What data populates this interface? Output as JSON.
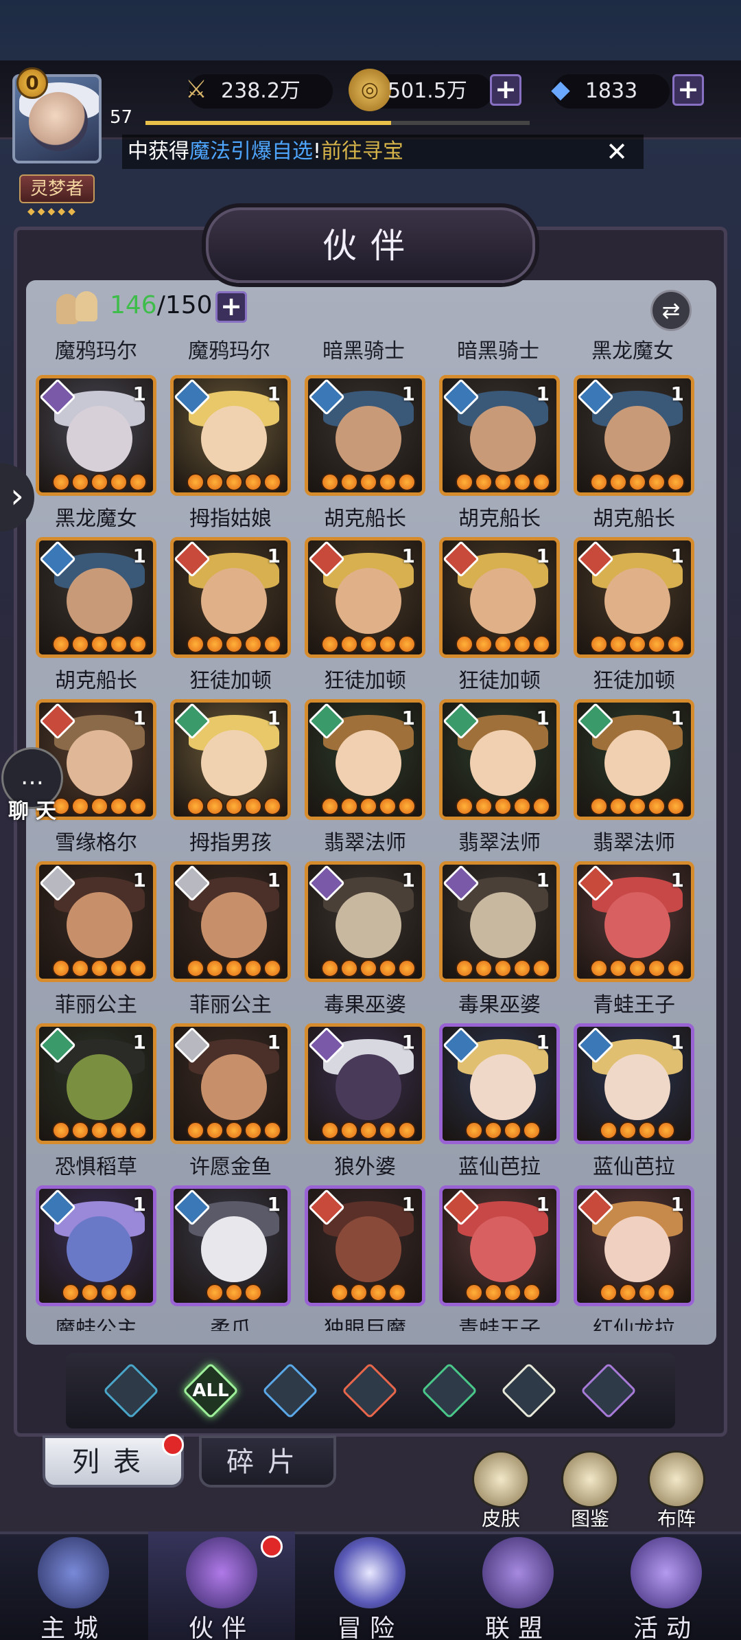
{
  "header": {
    "level_badge": "0",
    "player_level": "57",
    "xp_fraction": 0.64,
    "rank": "灵梦者",
    "rank_stars": "◆◆◆◆◆",
    "power": "238.2万",
    "gold": "501.5万",
    "diamonds": "1833",
    "plus": "+",
    "ticker_prefix": "中获得",
    "ticker_highlight": "魔法引爆自选",
    "ticker_mid": "!",
    "ticker_link": "前往寻宝",
    "ticker_close": "✕"
  },
  "page": {
    "title": "伙伴"
  },
  "roster": {
    "current": "146",
    "max": "/150",
    "plus": "+",
    "sort_icon": "⇄"
  },
  "header_names": [
    "魔鸦玛尔",
    "魔鸦玛尔",
    "暗黑骑士",
    "暗黑骑士",
    "黑龙魔女"
  ],
  "cards": [
    {
      "name": "黑龙魔女",
      "count": "1",
      "element": "dark",
      "frame": "orange",
      "theme": "witch"
    },
    {
      "name": "拇指姑娘",
      "count": "1",
      "element": "water",
      "frame": "orange",
      "theme": "blonde"
    },
    {
      "name": "胡克船长",
      "count": "1",
      "element": "water",
      "frame": "orange",
      "theme": "pirate"
    },
    {
      "name": "胡克船长",
      "count": "1",
      "element": "water",
      "frame": "orange",
      "theme": "pirate"
    },
    {
      "name": "胡克船长",
      "count": "1",
      "element": "water",
      "frame": "orange",
      "theme": "pirate"
    },
    {
      "name": "胡克船长",
      "count": "1",
      "element": "water",
      "frame": "orange",
      "theme": "pirate"
    },
    {
      "name": "狂徒加顿",
      "count": "1",
      "element": "fire",
      "frame": "orange",
      "theme": "gaston"
    },
    {
      "name": "狂徒加顿",
      "count": "1",
      "element": "fire",
      "frame": "orange",
      "theme": "gaston"
    },
    {
      "name": "狂徒加顿",
      "count": "1",
      "element": "fire",
      "frame": "orange",
      "theme": "gaston"
    },
    {
      "name": "狂徒加顿",
      "count": "1",
      "element": "fire",
      "frame": "orange",
      "theme": "gaston"
    },
    {
      "name": "雪缘格尔",
      "count": "1",
      "element": "fire",
      "frame": "orange",
      "theme": "boy"
    },
    {
      "name": "拇指男孩",
      "count": "1",
      "element": "wind",
      "frame": "orange",
      "theme": "blonde"
    },
    {
      "name": "翡翠法师",
      "count": "1",
      "element": "wind",
      "frame": "orange",
      "theme": "mage"
    },
    {
      "name": "翡翠法师",
      "count": "1",
      "element": "wind",
      "frame": "orange",
      "theme": "mage"
    },
    {
      "name": "翡翠法师",
      "count": "1",
      "element": "wind",
      "frame": "orange",
      "theme": "mage"
    },
    {
      "name": "菲丽公主",
      "count": "1",
      "element": "light",
      "frame": "orange",
      "theme": "princess"
    },
    {
      "name": "菲丽公主",
      "count": "1",
      "element": "light",
      "frame": "orange",
      "theme": "princess"
    },
    {
      "name": "毒果巫婆",
      "count": "1",
      "element": "dark",
      "frame": "orange",
      "theme": "hag"
    },
    {
      "name": "毒果巫婆",
      "count": "1",
      "element": "dark",
      "frame": "orange",
      "theme": "hag"
    },
    {
      "name": "青蛙王子",
      "count": "1",
      "element": "fire",
      "frame": "orange",
      "theme": "frog"
    },
    {
      "name": "恐惧稻草",
      "count": "1",
      "element": "wind",
      "frame": "orange",
      "theme": "scarecrow"
    },
    {
      "name": "许愿金鱼",
      "count": "1",
      "element": "light",
      "frame": "orange",
      "theme": "princess"
    },
    {
      "name": "狼外婆",
      "count": "1",
      "element": "dark",
      "frame": "orange",
      "theme": "wolf"
    },
    {
      "name": "蓝仙芭拉",
      "count": "1",
      "element": "water",
      "frame": "purple",
      "theme": "fairy"
    },
    {
      "name": "蓝仙芭拉",
      "count": "1",
      "element": "water",
      "frame": "purple",
      "theme": "fairy"
    },
    {
      "name": "魔蛙公主",
      "count": "1",
      "element": "water",
      "frame": "purple",
      "theme": "bluefrog"
    },
    {
      "name": "柔爪",
      "count": "1",
      "element": "water",
      "frame": "purple",
      "theme": "cat"
    },
    {
      "name": "独眼巨魔",
      "count": "1",
      "element": "fire",
      "frame": "purple",
      "theme": "troll"
    },
    {
      "name": "青蛙王子",
      "count": "1",
      "element": "fire",
      "frame": "purple",
      "theme": "frog"
    },
    {
      "name": "红仙龙拉",
      "count": "1",
      "element": "fire",
      "frame": "purple",
      "theme": "redfairy"
    }
  ],
  "star_counts": [
    5,
    5,
    5,
    5,
    5,
    5,
    5,
    5,
    5,
    5,
    5,
    5,
    5,
    5,
    5,
    5,
    5,
    5,
    5,
    5,
    5,
    5,
    5,
    4,
    4,
    4,
    3,
    4,
    4,
    4
  ],
  "filters": [
    {
      "name": "tide",
      "label": "",
      "color": "#4aa6c8"
    },
    {
      "name": "all",
      "label": "ALL",
      "color": "#9ef09a"
    },
    {
      "name": "water",
      "label": "",
      "color": "#5aa8e8"
    },
    {
      "name": "fire",
      "label": "",
      "color": "#e8664a"
    },
    {
      "name": "wind",
      "label": "",
      "color": "#4ac88a"
    },
    {
      "name": "light",
      "label": "",
      "color": "#e8e8d8"
    },
    {
      "name": "dark",
      "label": "",
      "color": "#a87ad8"
    }
  ],
  "tabs": {
    "list": "列表",
    "shards": "碎片"
  },
  "side_buttons": {
    "skin": "皮肤",
    "codex": "图鉴",
    "formation": "布阵"
  },
  "side": {
    "arrow": "›",
    "chat_icon": "…",
    "chat_label": "聊天"
  },
  "nav": [
    {
      "label": "主城",
      "icon": "castle-icon"
    },
    {
      "label": "伙伴",
      "icon": "wizard-hat-icon"
    },
    {
      "label": "冒险",
      "icon": "compass-icon"
    },
    {
      "label": "联盟",
      "icon": "shield-icon"
    },
    {
      "label": "活动",
      "icon": "cards-icon"
    }
  ],
  "colors": {
    "accent": "#3fbd4a",
    "frame_orange": "#d68b2c",
    "frame_purple": "#9a63d4"
  }
}
